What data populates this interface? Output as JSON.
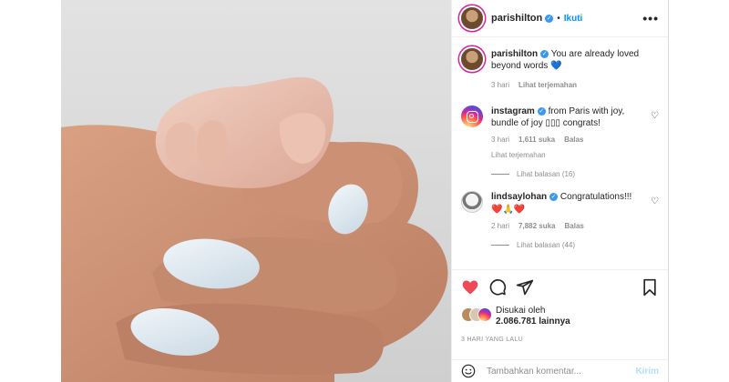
{
  "post": {
    "username": "parishilton",
    "follow_label": "Ikuti",
    "dot": "•",
    "more_label": "•••"
  },
  "caption": {
    "username": "parishilton",
    "text": "You are already loved beyond words 💙",
    "time": "3 hari",
    "translate": "Lihat terjemahan"
  },
  "comments": [
    {
      "username": "instagram",
      "text": "from Paris with joy, bundle of joy ▯▯▯ congrats!",
      "time": "3 hari",
      "likes": "1,611 suka",
      "reply": "Balas",
      "translate": "Lihat terjemahan",
      "view_replies": "Lihat balasan (16)"
    },
    {
      "username": "lindsaylohan",
      "text": "Congratulations!!!",
      "emojis": "❤️🙏❤️",
      "time": "2 hari",
      "likes": "7,882 suka",
      "reply": "Balas",
      "view_replies": "Lihat balasan (44)"
    }
  ],
  "likes": {
    "label": "Disukai oleh",
    "count": "2.086.781 lainnya"
  },
  "timestamp": "3 HARI YANG LALU",
  "add_comment": {
    "placeholder": "Tambahkan komentar...",
    "send_label": "Kirim"
  },
  "icons": {
    "like": "heart-filled",
    "comment": "speech-bubble",
    "share": "paper-plane",
    "save": "bookmark",
    "emoji": "smiley"
  },
  "colors": {
    "link_blue": "#0095f6",
    "heart_red": "#ed4956",
    "nail_color": "#dde8f0"
  }
}
